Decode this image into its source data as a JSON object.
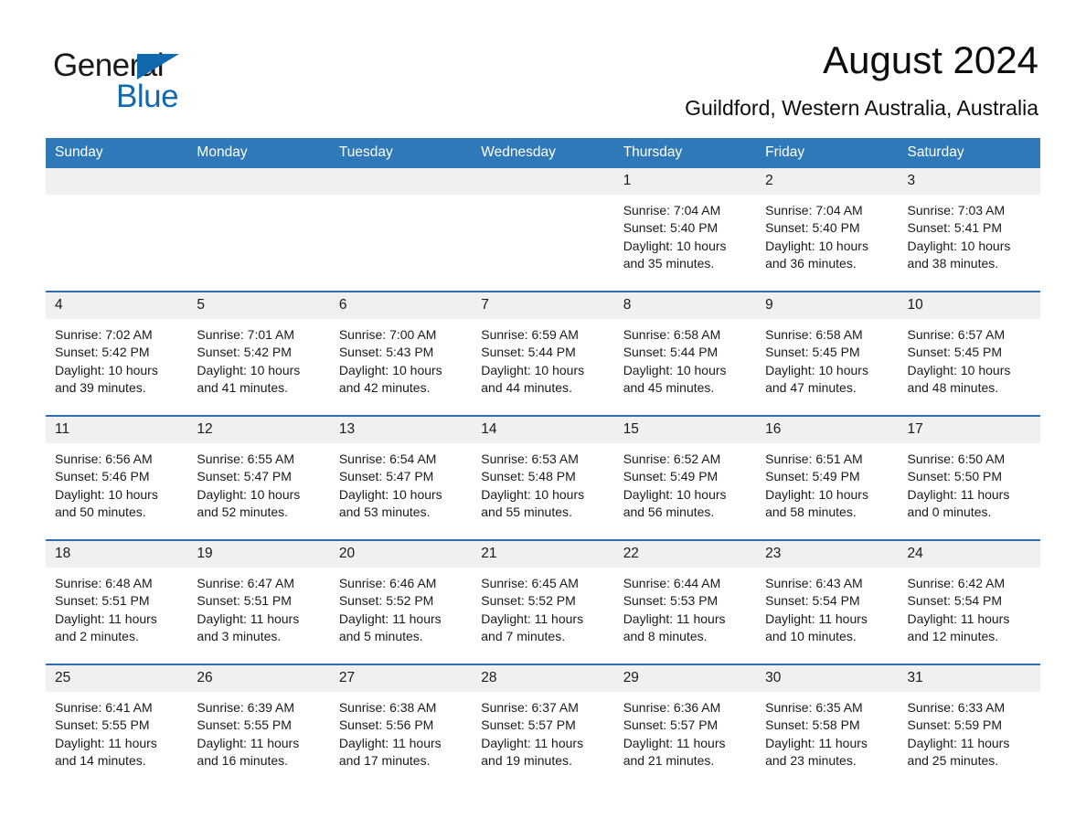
{
  "logo": {
    "word_one": "General",
    "word_two": "Blue",
    "triangle_color": "#1269b0"
  },
  "header": {
    "month_title": "August 2024",
    "location": "Guildford, Western Australia, Australia"
  },
  "theme": {
    "header_bg": "#3079b8",
    "row_divider": "#2f6fa8",
    "daynum_bg": "#f0f0f0"
  },
  "weekday_headers": [
    "Sunday",
    "Monday",
    "Tuesday",
    "Wednesday",
    "Thursday",
    "Friday",
    "Saturday"
  ],
  "labels": {
    "sunrise_prefix": "Sunrise:",
    "sunset_prefix": "Sunset:",
    "daylight_prefix": "Daylight:"
  },
  "weeks": [
    [
      {
        "day": "",
        "sunrise": "",
        "sunset": "",
        "daylight_a": "",
        "daylight_b": ""
      },
      {
        "day": "",
        "sunrise": "",
        "sunset": "",
        "daylight_a": "",
        "daylight_b": ""
      },
      {
        "day": "",
        "sunrise": "",
        "sunset": "",
        "daylight_a": "",
        "daylight_b": ""
      },
      {
        "day": "",
        "sunrise": "",
        "sunset": "",
        "daylight_a": "",
        "daylight_b": ""
      },
      {
        "day": "1",
        "sunrise": "Sunrise: 7:04 AM",
        "sunset": "Sunset: 5:40 PM",
        "daylight_a": "Daylight: 10 hours",
        "daylight_b": "and 35 minutes."
      },
      {
        "day": "2",
        "sunrise": "Sunrise: 7:04 AM",
        "sunset": "Sunset: 5:40 PM",
        "daylight_a": "Daylight: 10 hours",
        "daylight_b": "and 36 minutes."
      },
      {
        "day": "3",
        "sunrise": "Sunrise: 7:03 AM",
        "sunset": "Sunset: 5:41 PM",
        "daylight_a": "Daylight: 10 hours",
        "daylight_b": "and 38 minutes."
      }
    ],
    [
      {
        "day": "4",
        "sunrise": "Sunrise: 7:02 AM",
        "sunset": "Sunset: 5:42 PM",
        "daylight_a": "Daylight: 10 hours",
        "daylight_b": "and 39 minutes."
      },
      {
        "day": "5",
        "sunrise": "Sunrise: 7:01 AM",
        "sunset": "Sunset: 5:42 PM",
        "daylight_a": "Daylight: 10 hours",
        "daylight_b": "and 41 minutes."
      },
      {
        "day": "6",
        "sunrise": "Sunrise: 7:00 AM",
        "sunset": "Sunset: 5:43 PM",
        "daylight_a": "Daylight: 10 hours",
        "daylight_b": "and 42 minutes."
      },
      {
        "day": "7",
        "sunrise": "Sunrise: 6:59 AM",
        "sunset": "Sunset: 5:44 PM",
        "daylight_a": "Daylight: 10 hours",
        "daylight_b": "and 44 minutes."
      },
      {
        "day": "8",
        "sunrise": "Sunrise: 6:58 AM",
        "sunset": "Sunset: 5:44 PM",
        "daylight_a": "Daylight: 10 hours",
        "daylight_b": "and 45 minutes."
      },
      {
        "day": "9",
        "sunrise": "Sunrise: 6:58 AM",
        "sunset": "Sunset: 5:45 PM",
        "daylight_a": "Daylight: 10 hours",
        "daylight_b": "and 47 minutes."
      },
      {
        "day": "10",
        "sunrise": "Sunrise: 6:57 AM",
        "sunset": "Sunset: 5:45 PM",
        "daylight_a": "Daylight: 10 hours",
        "daylight_b": "and 48 minutes."
      }
    ],
    [
      {
        "day": "11",
        "sunrise": "Sunrise: 6:56 AM",
        "sunset": "Sunset: 5:46 PM",
        "daylight_a": "Daylight: 10 hours",
        "daylight_b": "and 50 minutes."
      },
      {
        "day": "12",
        "sunrise": "Sunrise: 6:55 AM",
        "sunset": "Sunset: 5:47 PM",
        "daylight_a": "Daylight: 10 hours",
        "daylight_b": "and 52 minutes."
      },
      {
        "day": "13",
        "sunrise": "Sunrise: 6:54 AM",
        "sunset": "Sunset: 5:47 PM",
        "daylight_a": "Daylight: 10 hours",
        "daylight_b": "and 53 minutes."
      },
      {
        "day": "14",
        "sunrise": "Sunrise: 6:53 AM",
        "sunset": "Sunset: 5:48 PM",
        "daylight_a": "Daylight: 10 hours",
        "daylight_b": "and 55 minutes."
      },
      {
        "day": "15",
        "sunrise": "Sunrise: 6:52 AM",
        "sunset": "Sunset: 5:49 PM",
        "daylight_a": "Daylight: 10 hours",
        "daylight_b": "and 56 minutes."
      },
      {
        "day": "16",
        "sunrise": "Sunrise: 6:51 AM",
        "sunset": "Sunset: 5:49 PM",
        "daylight_a": "Daylight: 10 hours",
        "daylight_b": "and 58 minutes."
      },
      {
        "day": "17",
        "sunrise": "Sunrise: 6:50 AM",
        "sunset": "Sunset: 5:50 PM",
        "daylight_a": "Daylight: 11 hours",
        "daylight_b": "and 0 minutes."
      }
    ],
    [
      {
        "day": "18",
        "sunrise": "Sunrise: 6:48 AM",
        "sunset": "Sunset: 5:51 PM",
        "daylight_a": "Daylight: 11 hours",
        "daylight_b": "and 2 minutes."
      },
      {
        "day": "19",
        "sunrise": "Sunrise: 6:47 AM",
        "sunset": "Sunset: 5:51 PM",
        "daylight_a": "Daylight: 11 hours",
        "daylight_b": "and 3 minutes."
      },
      {
        "day": "20",
        "sunrise": "Sunrise: 6:46 AM",
        "sunset": "Sunset: 5:52 PM",
        "daylight_a": "Daylight: 11 hours",
        "daylight_b": "and 5 minutes."
      },
      {
        "day": "21",
        "sunrise": "Sunrise: 6:45 AM",
        "sunset": "Sunset: 5:52 PM",
        "daylight_a": "Daylight: 11 hours",
        "daylight_b": "and 7 minutes."
      },
      {
        "day": "22",
        "sunrise": "Sunrise: 6:44 AM",
        "sunset": "Sunset: 5:53 PM",
        "daylight_a": "Daylight: 11 hours",
        "daylight_b": "and 8 minutes."
      },
      {
        "day": "23",
        "sunrise": "Sunrise: 6:43 AM",
        "sunset": "Sunset: 5:54 PM",
        "daylight_a": "Daylight: 11 hours",
        "daylight_b": "and 10 minutes."
      },
      {
        "day": "24",
        "sunrise": "Sunrise: 6:42 AM",
        "sunset": "Sunset: 5:54 PM",
        "daylight_a": "Daylight: 11 hours",
        "daylight_b": "and 12 minutes."
      }
    ],
    [
      {
        "day": "25",
        "sunrise": "Sunrise: 6:41 AM",
        "sunset": "Sunset: 5:55 PM",
        "daylight_a": "Daylight: 11 hours",
        "daylight_b": "and 14 minutes."
      },
      {
        "day": "26",
        "sunrise": "Sunrise: 6:39 AM",
        "sunset": "Sunset: 5:55 PM",
        "daylight_a": "Daylight: 11 hours",
        "daylight_b": "and 16 minutes."
      },
      {
        "day": "27",
        "sunrise": "Sunrise: 6:38 AM",
        "sunset": "Sunset: 5:56 PM",
        "daylight_a": "Daylight: 11 hours",
        "daylight_b": "and 17 minutes."
      },
      {
        "day": "28",
        "sunrise": "Sunrise: 6:37 AM",
        "sunset": "Sunset: 5:57 PM",
        "daylight_a": "Daylight: 11 hours",
        "daylight_b": "and 19 minutes."
      },
      {
        "day": "29",
        "sunrise": "Sunrise: 6:36 AM",
        "sunset": "Sunset: 5:57 PM",
        "daylight_a": "Daylight: 11 hours",
        "daylight_b": "and 21 minutes."
      },
      {
        "day": "30",
        "sunrise": "Sunrise: 6:35 AM",
        "sunset": "Sunset: 5:58 PM",
        "daylight_a": "Daylight: 11 hours",
        "daylight_b": "and 23 minutes."
      },
      {
        "day": "31",
        "sunrise": "Sunrise: 6:33 AM",
        "sunset": "Sunset: 5:59 PM",
        "daylight_a": "Daylight: 11 hours",
        "daylight_b": "and 25 minutes."
      }
    ]
  ]
}
